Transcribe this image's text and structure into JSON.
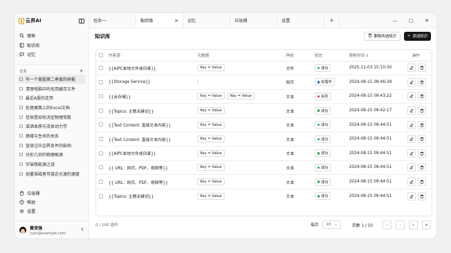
{
  "app": {
    "logo_text": "云界AI"
  },
  "sidebar": {
    "nav": [
      {
        "label": "搜索",
        "icon": "search-icon"
      },
      {
        "label": "知识库",
        "icon": "book-icon"
      },
      {
        "label": "记忆",
        "icon": "memory-icon"
      }
    ],
    "tasks_label": "任务",
    "tasks": [
      "写一个美股第二季度的研报",
      "清理电脑中的无用缓存文件",
      "最近A股的走势",
      "处理桌面上的Excel文档",
      "信探是如何决定物理常数",
      "滋洒本质与流体动力学",
      "熵增与生命的关系",
      "宣穿过中边界条件的影响",
      "分形几何的物理根源",
      "宇宙暗能源之谜",
      "如量准磁者可接近光速的速度"
    ],
    "bottom": [
      {
        "label": "垃圾桶",
        "icon": "trash-icon"
      },
      {
        "label": "帮助",
        "icon": "help-icon"
      },
      {
        "label": "设置",
        "icon": "gear-icon"
      }
    ],
    "user": {
      "name": "黄坚强",
      "email": "ryan@example.com"
    }
  },
  "tabs": [
    {
      "label": "任务一",
      "active": false
    },
    {
      "label": "知识库",
      "active": true
    },
    {
      "label": "记忆",
      "active": false
    },
    {
      "label": "垃圾桶",
      "active": false
    },
    {
      "label": "设置",
      "active": false
    }
  ],
  "page": {
    "title": "知识库",
    "delete_button": "删除所选知识",
    "add_button": "添加知识"
  },
  "table": {
    "headers": {
      "content": "内容源",
      "meta": "元数据",
      "type": "种类",
      "status": "状态",
      "updated": "更新时间",
      "ops": "操作"
    },
    "rows": [
      {
        "content": "{{AIPC本地文件或目录}}",
        "meta": [
          "Key = Value"
        ],
        "type": "文件",
        "status": "成功",
        "status_color": "#22a84a",
        "time": "2025-11-03 15:10:30"
      },
      {
        "content": "{{Storage Service}}",
        "meta": [],
        "meta_empty": "/",
        "type": "网页",
        "status": "处理中",
        "status_color": "#1f5fe0",
        "time": "2024-08-15 09:46:39"
      },
      {
        "content": "{{云存储}}",
        "meta": [
          "Key = Value",
          "Key = Value"
        ],
        "type": "文本",
        "status": "失败",
        "status_color": "#e5322d",
        "time": "2024-08-15 09:43:22"
      },
      {
        "content": "{{Topics: 主题关键词}}",
        "meta": [
          "Key = Value"
        ],
        "type": "文本",
        "status": "成功",
        "status_color": "#22a84a",
        "time": "2024-08-15 09:42:17"
      },
      {
        "content": "{{Text Content: 直接文本内容}}",
        "meta": [
          "Key = Value"
        ],
        "type": "文本",
        "status": "成功",
        "status_color": "#22a84a",
        "time": "2024-08-15 09:44:51"
      },
      {
        "content": "{{Text Content: 直接文本内容}}",
        "meta": [
          "Key = Value"
        ],
        "type": "文本",
        "status": "成功",
        "status_color": "#22a84a",
        "time": "2024-08-15 09:44:51"
      },
      {
        "content": "{{AIPC本地文件或目录}}",
        "meta": [
          "Key = Value"
        ],
        "type": "文本",
        "status": "成功",
        "status_color": "#22a84a",
        "time": "2024-08-15 09:44:51"
      },
      {
        "content": "{{ URL：网页、PDF、视频等}}",
        "meta": [
          "Key = Value"
        ],
        "type": "文本",
        "status": "成功",
        "status_color": "#22a84a",
        "time": "2024-08-15 09:44:51"
      },
      {
        "content": "{{ URL：网页、PDF、视频等}}",
        "meta": [
          "Key = Value"
        ],
        "type": "文本",
        "status": "成功",
        "status_color": "#22a84a",
        "time": "2024-08-15 09:44:51"
      },
      {
        "content": "{{Topics: 主题关键词}}",
        "meta": [
          "Key = Value"
        ],
        "type": "文本",
        "status": "成功",
        "status_color": "#22a84a",
        "time": "2024-08-15 09:44:51"
      }
    ]
  },
  "footer": {
    "selection": "0 / 100 选中",
    "per_page_label": "每页",
    "per_page_value": "10",
    "page_info": "页数 1 / 10"
  }
}
